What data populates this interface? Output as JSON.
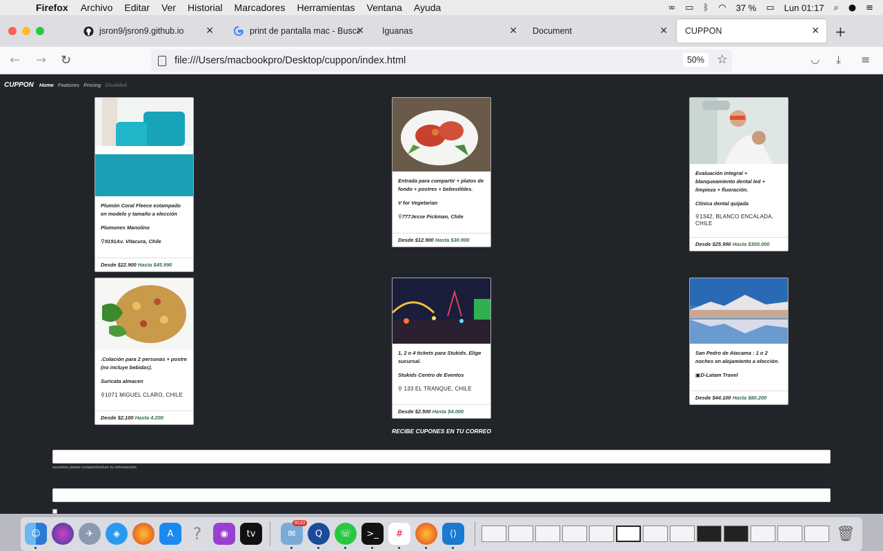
{
  "menubar": {
    "app_name": "Firefox",
    "items": [
      "Archivo",
      "Editar",
      "Ver",
      "Historial",
      "Marcadores",
      "Herramientas",
      "Ventana",
      "Ayuda"
    ],
    "battery": "37 %",
    "clock": "Lun 01:17"
  },
  "tabs": [
    {
      "title": "jsron9/jsron9.github.io",
      "icon": "github-icon"
    },
    {
      "title": "print de pantalla mac - Buscar",
      "icon": "google-icon"
    },
    {
      "title": "Iguanas",
      "icon": ""
    },
    {
      "title": "Document",
      "icon": ""
    },
    {
      "title": "CUPPON",
      "icon": ""
    }
  ],
  "navbar": {
    "url": "file:///Users/macbookpro/Desktop/cuppon/index.html",
    "zoom": "50%"
  },
  "site": {
    "brand": "CUPPON",
    "nav": {
      "home": "Home",
      "features": "Features",
      "pricing": "Pricing",
      "disabled": "Disabled"
    },
    "newsletter_title": "RECIBE CUPONES EN TU CORREO",
    "email_help": "nosotros jamás compartiremos tu información."
  },
  "cards": [
    {
      "desc": "Plumón Coral Fleece estampado en modelo y tamaño a elección",
      "seller": "Plumones Manolino",
      "address": "9191Av. Vitacura, Chile",
      "from": "Desde $22.900",
      "to": "Hasta $45.990"
    },
    {
      "desc": "Entrada para compartir + platos de fondo + postres + bebestibles.",
      "seller": "V for Vegetarian",
      "address": "777Jesse Pickman, Chile",
      "from": "Desde $12.900",
      "to": "Hasta $30.900"
    },
    {
      "desc": "Evaluación integral + blanqueamiento dental led + limpieza + fluoración.",
      "seller": "Clínica dental quijada",
      "address": "1342, BLANCO ENCALADA, CHILE",
      "from": "Desde $25.990",
      "to": "Hasta $300.000"
    },
    {
      "desc": ".Colación para 2 personas + postre (no incluye bebidas).",
      "seller": "Suricata almacen",
      "address": "1071 MIGUEL CLARO, CHILE",
      "from": "Desde $2.100",
      "to": "Hasta 4.200"
    },
    {
      "desc": "1, 2 o 4 tickets para Stukids. Elige sucursal.",
      "seller": "Stukids Centro de Eventos",
      "address": "133 EL TRANQUE, CHILE",
      "from": "Desde $2.500",
      "to": "Hasta $4.000"
    },
    {
      "desc": "San Pedro de Atacama : 1 o 2 noches en alojamiento a elección.",
      "seller": "D-Latam Travel",
      "address": "",
      "from": "Desde $44.100",
      "to": "Hasta $80.200"
    }
  ],
  "dock": {
    "mail_badge": "9110"
  },
  "colors": {
    "page_bg": "#212529",
    "price_accent": "#2e6b4e"
  }
}
